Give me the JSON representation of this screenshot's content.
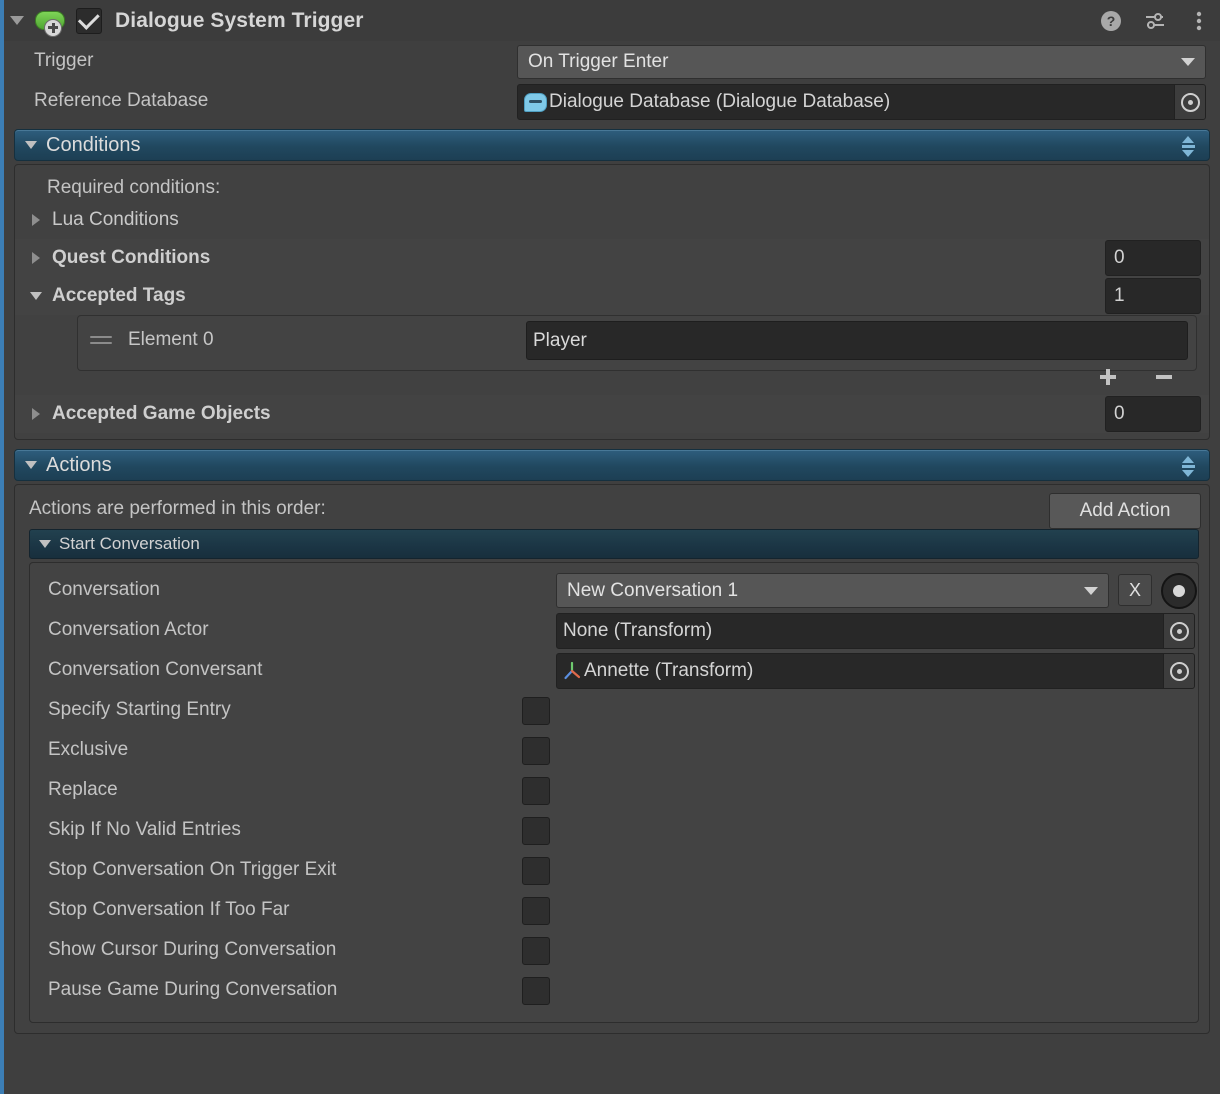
{
  "component": {
    "title": "Dialogue System Trigger",
    "enabled_checkbox": true,
    "icon": "capsule-collider-add-icon",
    "header_icons": [
      "help-icon",
      "preset-icon",
      "more-menu-icon"
    ]
  },
  "properties": {
    "trigger": {
      "label": "Trigger",
      "value": "On Trigger Enter"
    },
    "reference_database": {
      "label": "Reference Database",
      "value": "Dialogue Database (Dialogue Database)",
      "icon": "dialogue-database-icon"
    }
  },
  "conditions": {
    "header": "Conditions",
    "intro": "Required conditions:",
    "lua_conditions": {
      "label": "Lua Conditions",
      "expanded": false
    },
    "quest_conditions": {
      "label": "Quest Conditions",
      "count": "0",
      "expanded": false
    },
    "accepted_tags": {
      "label": "Accepted Tags",
      "count": "1",
      "expanded": true,
      "elements": [
        {
          "label": "Element 0",
          "value": "Player"
        }
      ],
      "add_button": "+",
      "remove_button": "-"
    },
    "accepted_game_objects": {
      "label": "Accepted Game Objects",
      "count": "0",
      "expanded": false
    }
  },
  "actions": {
    "header": "Actions",
    "intro": "Actions are performed in this order:",
    "add_action_label": "Add Action",
    "start_conversation": {
      "header": "Start Conversation",
      "expanded": true,
      "fields": [
        {
          "label": "Conversation",
          "type": "dropdown",
          "value": "New Conversation 1",
          "clear_label": "X",
          "target_icon": "target-dot-icon"
        },
        {
          "label": "Conversation Actor",
          "type": "object",
          "value": "None (Transform)",
          "icon": "none"
        },
        {
          "label": "Conversation Conversant",
          "type": "object",
          "value": "Annette (Transform)",
          "icon": "transform-icon"
        }
      ],
      "toggles": [
        {
          "label": "Specify Starting Entry",
          "checked": false
        },
        {
          "label": "Exclusive",
          "checked": false
        },
        {
          "label": "Replace",
          "checked": false
        },
        {
          "label": "Skip If No Valid Entries",
          "checked": false
        },
        {
          "label": "Stop Conversation On Trigger Exit",
          "checked": false
        },
        {
          "label": "Stop Conversation If Too Far",
          "checked": false
        },
        {
          "label": "Show Cursor During Conversation",
          "checked": false
        },
        {
          "label": "Pause Game During Conversation",
          "checked": false
        }
      ]
    }
  },
  "colors": {
    "panel_bg": "#3f3f3f",
    "header_bg": "#3c3c3c",
    "section_blue": "#23495f",
    "sub_section_blue": "#1b3544",
    "override_strip": "#3c7eb5",
    "field_dark": "#282828",
    "dropdown_bg": "#565656",
    "text": "#c8c8c8"
  }
}
